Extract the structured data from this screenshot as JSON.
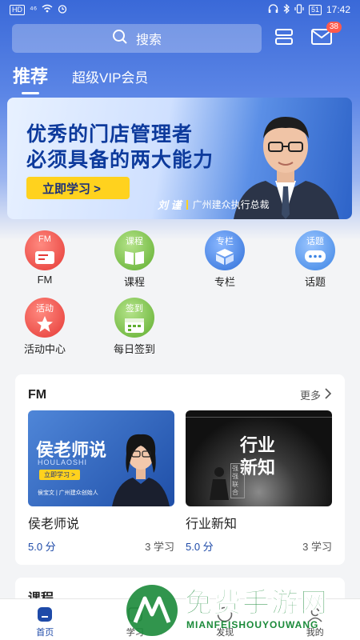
{
  "status_bar": {
    "left_badge": "HD",
    "signal": "⁴⁶",
    "battery": "51",
    "time": "17:42"
  },
  "search": {
    "placeholder": "搜索"
  },
  "header": {
    "mail_badge": "38"
  },
  "tabs": [
    {
      "label": "推荐",
      "active": true
    },
    {
      "label": "超级VIP会员",
      "active": false
    }
  ],
  "banner": {
    "line1": "优秀的门店管理者",
    "line2": "必须具备的两大能力",
    "button": "立即学习 >",
    "caption_name": "刘 谨",
    "caption_role": "广州建众执行总裁"
  },
  "grid": [
    {
      "label": "FM",
      "tag": "FM",
      "color": "#ef5350"
    },
    {
      "label": "课程",
      "tag": "课程",
      "color": "#7cc242"
    },
    {
      "label": "专栏",
      "tag": "专栏",
      "color": "#3d7fe0"
    },
    {
      "label": "话题",
      "tag": "话题",
      "color": "#4a90e8"
    },
    {
      "label": "活动中心",
      "tag": "活动",
      "color": "#ef5350"
    },
    {
      "label": "每日签到",
      "tag": "签到",
      "color": "#7cc242"
    }
  ],
  "fm_card": {
    "title": "FM",
    "more": "更多",
    "items": [
      {
        "name": "侯老师说",
        "score": "5.0 分",
        "learners": "3 学习",
        "thumb_title": "侯老师说",
        "thumb_sub": "HOULAOSHI",
        "thumb_btn": "立即学习 >",
        "thumb_caption": "侯宝文 | 广州建众创始人"
      },
      {
        "name": "行业新知",
        "score": "5.0 分",
        "learners": "3 学习",
        "thumb_title": "行业",
        "thumb_title2": "新知",
        "thumb_tag": "强强联合"
      }
    ]
  },
  "course_card": {
    "title": "课程"
  },
  "bottom_nav": [
    {
      "label": "首页",
      "active": true
    },
    {
      "label": "学习",
      "active": false
    },
    {
      "label": "发现",
      "active": false
    },
    {
      "label": "我的",
      "active": false
    }
  ],
  "watermark": {
    "text": "免费手游网",
    "sub": "MIANFEISHOUYOUWANG"
  }
}
